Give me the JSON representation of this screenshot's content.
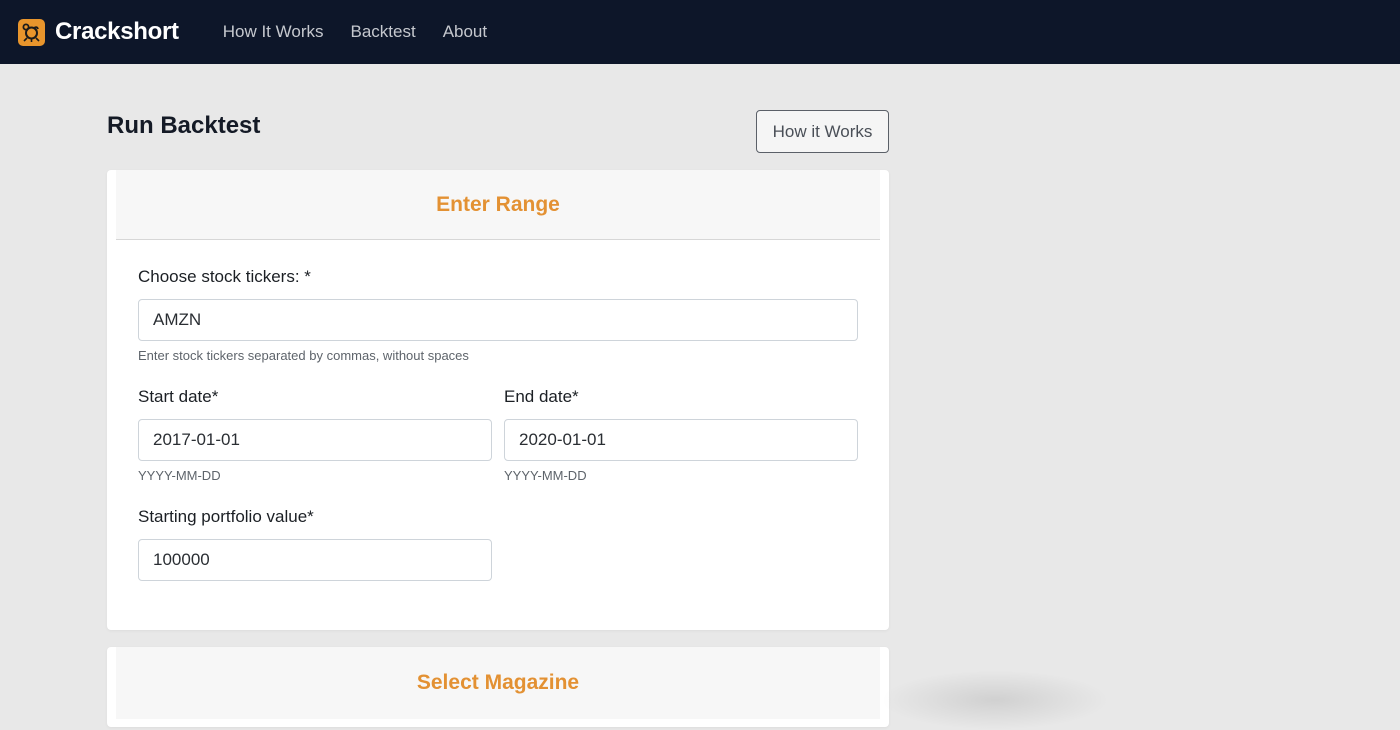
{
  "navbar": {
    "brand": "Crackshort",
    "logo_icon": "crab-logo-icon",
    "links": [
      "How It Works",
      "Backtest",
      "About"
    ]
  },
  "main": {
    "title": "Run Backtest",
    "how_it_works_button": "How it Works"
  },
  "range_card": {
    "header": "Enter Range",
    "tickers": {
      "label": "Choose stock tickers: *",
      "value": "AMZN",
      "help": "Enter stock tickers separated by commas, without spaces"
    },
    "start_date": {
      "label": "Start date*",
      "value": "2017-01-01",
      "help": "YYYY-MM-DD"
    },
    "end_date": {
      "label": "End date*",
      "value": "2020-01-01",
      "help": "YYYY-MM-DD"
    },
    "portfolio": {
      "label": "Starting portfolio value*",
      "value": "100000"
    }
  },
  "magazine_card": {
    "header": "Select Magazine"
  },
  "colors": {
    "navbar_bg": "#0d1629",
    "accent": "#e39133",
    "page_bg": "#e8e8e8"
  }
}
